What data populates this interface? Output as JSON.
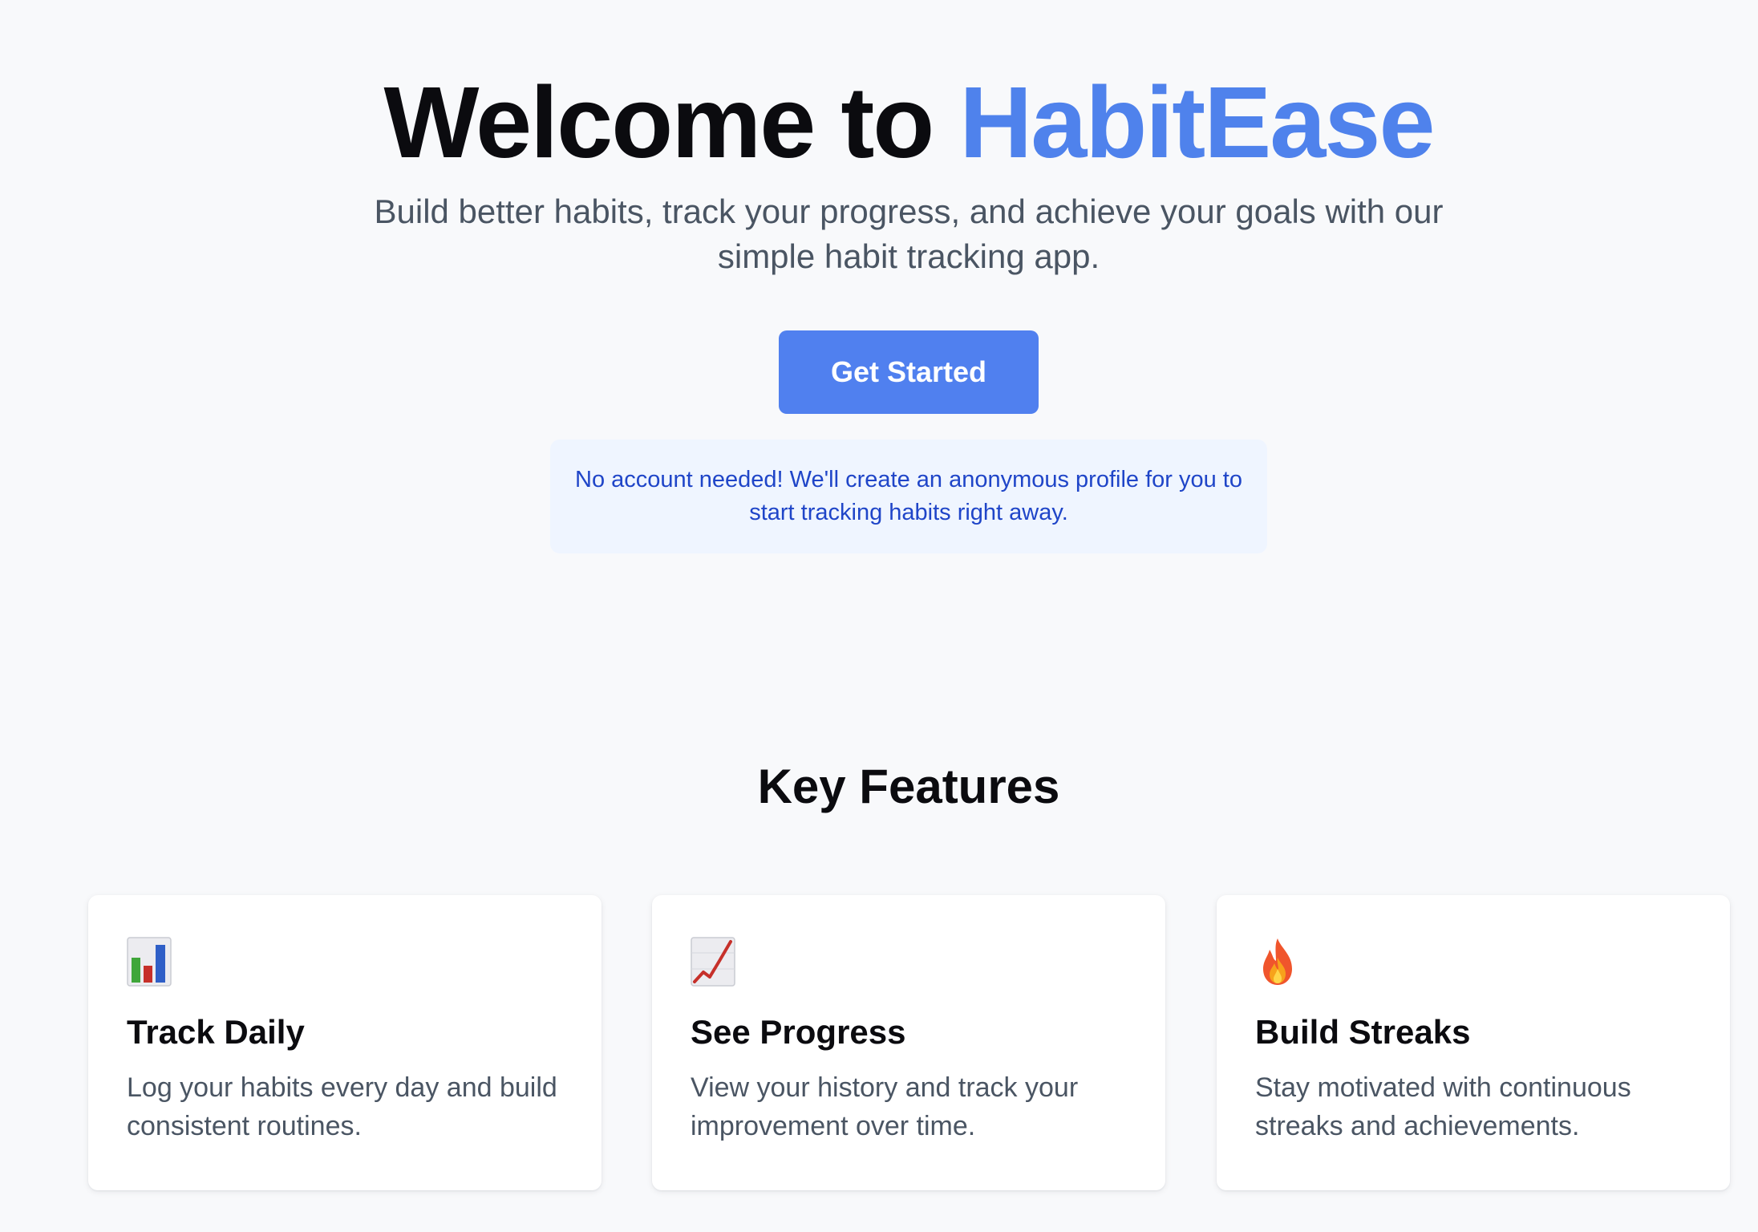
{
  "hero": {
    "title_prefix": "Welcome to ",
    "title_brand": "HabitEase",
    "subtitle": "Build better habits, track your progress, and achieve your goals with our simple habit tracking app.",
    "cta_label": "Get Started",
    "note": "No account needed! We'll create an anonymous profile for you to start tracking habits right away."
  },
  "features": {
    "heading": "Key Features",
    "items": [
      {
        "icon": "bar-chart-icon",
        "title": "Track Daily",
        "description": "Log your habits every day and build consistent routines."
      },
      {
        "icon": "chart-increasing-icon",
        "title": "See Progress",
        "description": "View your history and track your improvement over time."
      },
      {
        "icon": "fire-icon",
        "title": "Build Streaks",
        "description": "Stay motivated with continuous streaks and achievements."
      }
    ]
  },
  "colors": {
    "brand": "#4f82ec",
    "button": "#5080ef",
    "note_background": "#eff5ff",
    "note_text": "#1f45c8",
    "page_background": "#f8f9fb"
  }
}
